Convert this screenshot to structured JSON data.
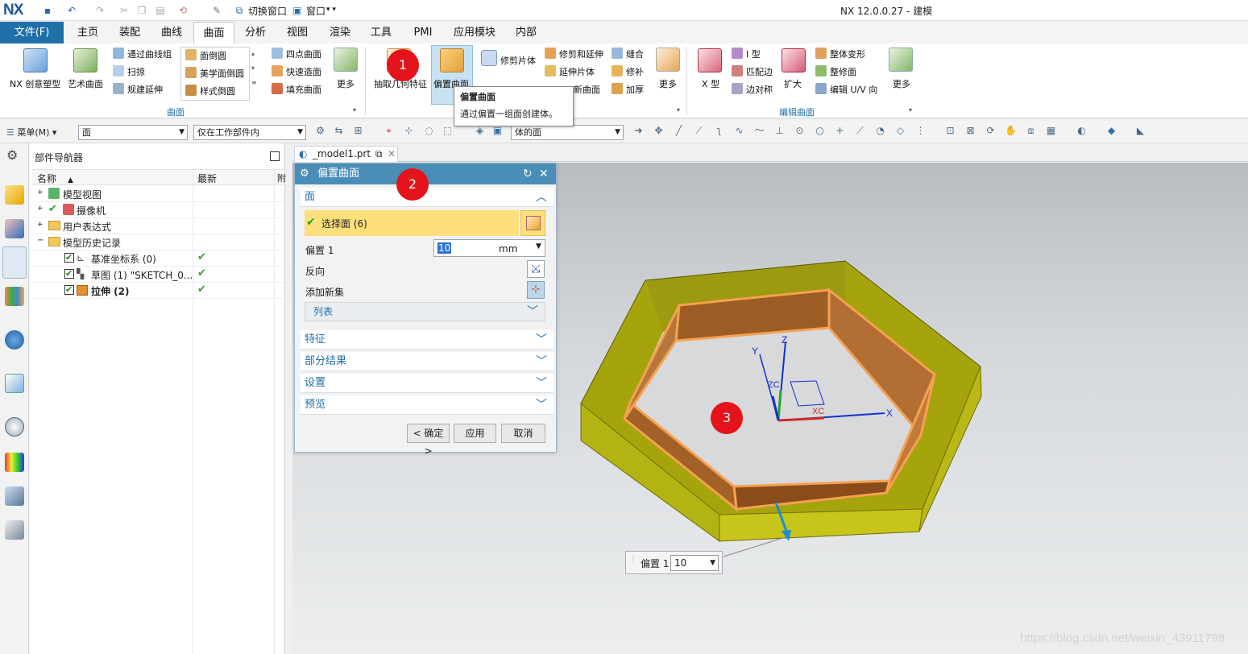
{
  "app": {
    "logo": "NX",
    "window_title": "NX 12.0.0.27 - 建模",
    "switch_window": "切换窗口",
    "window_menu": "窗口"
  },
  "ribbon_tabs": [
    "文件(F)",
    "主页",
    "装配",
    "曲线",
    "曲面",
    "分析",
    "视图",
    "渲染",
    "工具",
    "PMI",
    "应用模块",
    "内部"
  ],
  "active_tab": "曲面",
  "ribbon": {
    "nx_creative": "NX 创意塑型",
    "art_surface": "艺术曲面",
    "through_curve_mesh": "通过曲线组",
    "sweep": "扫掠",
    "ruled_extend": "规建延伸",
    "face_blend": "面倒圆",
    "aesthetic_blend": "美学面倒圆",
    "styled_blend": "样式倒圆",
    "four_point_surface": "四点曲面",
    "quick_surface": "快速造面",
    "fill_surface": "填充曲面",
    "more1": "更多",
    "group_surface": "曲面",
    "extract_feature": "抽取几何特征",
    "offset_surface": "偏置曲面",
    "trim_sheet": "修剪片体",
    "trim_extend": "修剪和延伸",
    "extend_sheet": "延伸片体",
    "new_surface": "新曲面",
    "sew": "缝合",
    "patch": "修补",
    "thicken": "加厚",
    "more2": "更多",
    "x_form": "X 型",
    "i_form": "I 型",
    "match_edge": "匹配边",
    "edge_symmetry": "边对称",
    "enlarge": "扩大",
    "global_deform": "整体变形",
    "face_repair": "整修面",
    "edit_uv": "编辑 U/V 向",
    "more3": "更多",
    "group_edit": "编辑曲面"
  },
  "tooltip": {
    "title": "偏置曲面",
    "desc": "通过偏置一组面创建体。"
  },
  "selection_bar": {
    "menu": "菜单(M)",
    "filter": "面",
    "scope": "仅在工作部件内",
    "face_rule": "体的面"
  },
  "navigator": {
    "title": "部件导航器",
    "col_name": "名称",
    "col_latest": "最新",
    "col_extra": "附",
    "rows": [
      {
        "label": "模型视图",
        "check": ""
      },
      {
        "label": "摄像机",
        "check": ""
      },
      {
        "label": "用户表达式",
        "check": ""
      },
      {
        "label": "模型历史记录",
        "check": ""
      },
      {
        "label": "基准坐标系 (0)",
        "check": "✔"
      },
      {
        "label": "草图 (1) \"SKETCH_0...",
        "check": "✔"
      },
      {
        "label": "拉伸 (2)",
        "check": "✔"
      }
    ]
  },
  "doc_tab": "_model1.prt",
  "dialog": {
    "title": "偏置曲面",
    "sect_face": "面",
    "select_face": "选择面 (6)",
    "offset_label": "偏置 1",
    "offset_value": "10",
    "offset_unit": "mm",
    "reverse": "反向",
    "add_new_set": "添加新集",
    "list": "列表",
    "sect_feature": "特征",
    "sect_partial": "部分结果",
    "sect_settings": "设置",
    "sect_preview": "预览",
    "ok": "< 确定 >",
    "apply": "应用",
    "cancel": "取消"
  },
  "onscreen_input": {
    "label": "偏置 1",
    "value": "10"
  },
  "axes": {
    "z": "Z",
    "y": "Y",
    "x": "X",
    "zc": "ZC",
    "xc": "XC"
  },
  "badges": [
    "1",
    "2",
    "3"
  ],
  "watermark": "https://blog.csdn.net/weixin_43911798",
  "colors": {
    "accent": "#1f6fa8",
    "dialog_title": "#4a8eb8",
    "select_highlight": "#fddf7c",
    "badge": "#e5131b",
    "outer_wall": "#b5b312",
    "inner_wall": "#a86a33",
    "edge_highlight": "#f5a150"
  }
}
